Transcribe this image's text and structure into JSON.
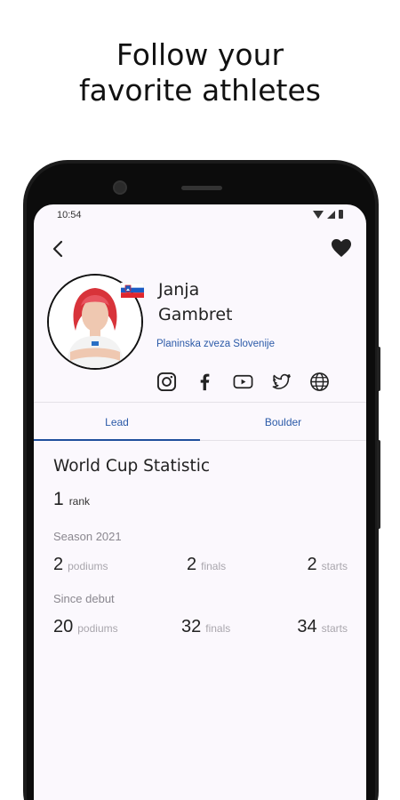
{
  "headline": {
    "line1": "Follow your",
    "line2": "favorite athletes"
  },
  "status_bar": {
    "time": "10:54"
  },
  "athlete": {
    "first_name": "Janja",
    "last_name": "Gambret",
    "federation": "Planinska zveza Slovenije",
    "flag": "slovenia-flag"
  },
  "socials": [
    "instagram-icon",
    "facebook-icon",
    "youtube-icon",
    "twitter-icon",
    "globe-icon"
  ],
  "tabs": [
    {
      "label": "Lead",
      "active": true
    },
    {
      "label": "Boulder",
      "active": false
    }
  ],
  "stats": {
    "title": "World Cup Statistic",
    "rank": {
      "value": "1",
      "unit": "rank"
    },
    "season": {
      "label": "Season 2021",
      "podiums": "2",
      "podiums_unit": "podiums",
      "finals": "2",
      "finals_unit": "finals",
      "starts": "2",
      "starts_unit": "starts"
    },
    "debut": {
      "label": "Since debut",
      "podiums": "20",
      "podiums_unit": "podiums",
      "finals": "32",
      "finals_unit": "finals",
      "starts": "34",
      "starts_unit": "starts"
    }
  },
  "colors": {
    "accent": "#2b5aa8",
    "tab_indicator": "#1f4f9c",
    "screen_bg": "#fbf8fd",
    "hair": "#d8333a"
  }
}
